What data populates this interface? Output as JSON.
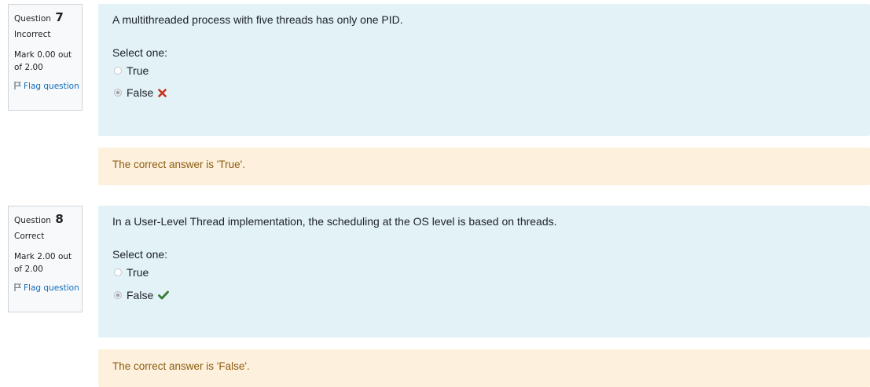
{
  "questions": [
    {
      "label": "Question",
      "number": "7",
      "state": "Incorrect",
      "grade": "Mark 0.00 out of 2.00",
      "flag": "Flag question",
      "text": "A multithreaded process with five threads has only one PID.",
      "prompt": "Select one:",
      "options": [
        {
          "label": "True",
          "selected": false
        },
        {
          "label": "False",
          "selected": true,
          "mark": "incorrect-icon"
        }
      ],
      "feedback": "The correct answer is 'True'."
    },
    {
      "label": "Question",
      "number": "8",
      "state": "Correct",
      "grade": "Mark 2.00 out of 2.00",
      "flag": "Flag question",
      "text": "In a User-Level Thread implementation, the scheduling at the OS level is based on threads.",
      "prompt": "Select one:",
      "options": [
        {
          "label": "True",
          "selected": false
        },
        {
          "label": "False",
          "selected": true,
          "mark": "correct-icon"
        }
      ],
      "feedback": "The correct answer is 'False'."
    }
  ],
  "colors": {
    "info_bg": "#f8f9fa",
    "formulation_bg": "#e2f2f7",
    "feedback_bg": "#fdf0dc",
    "feedback_text": "#8d5c12",
    "link": "#0f6cbf",
    "incorrect": "#ca3120",
    "correct": "#357a32"
  }
}
